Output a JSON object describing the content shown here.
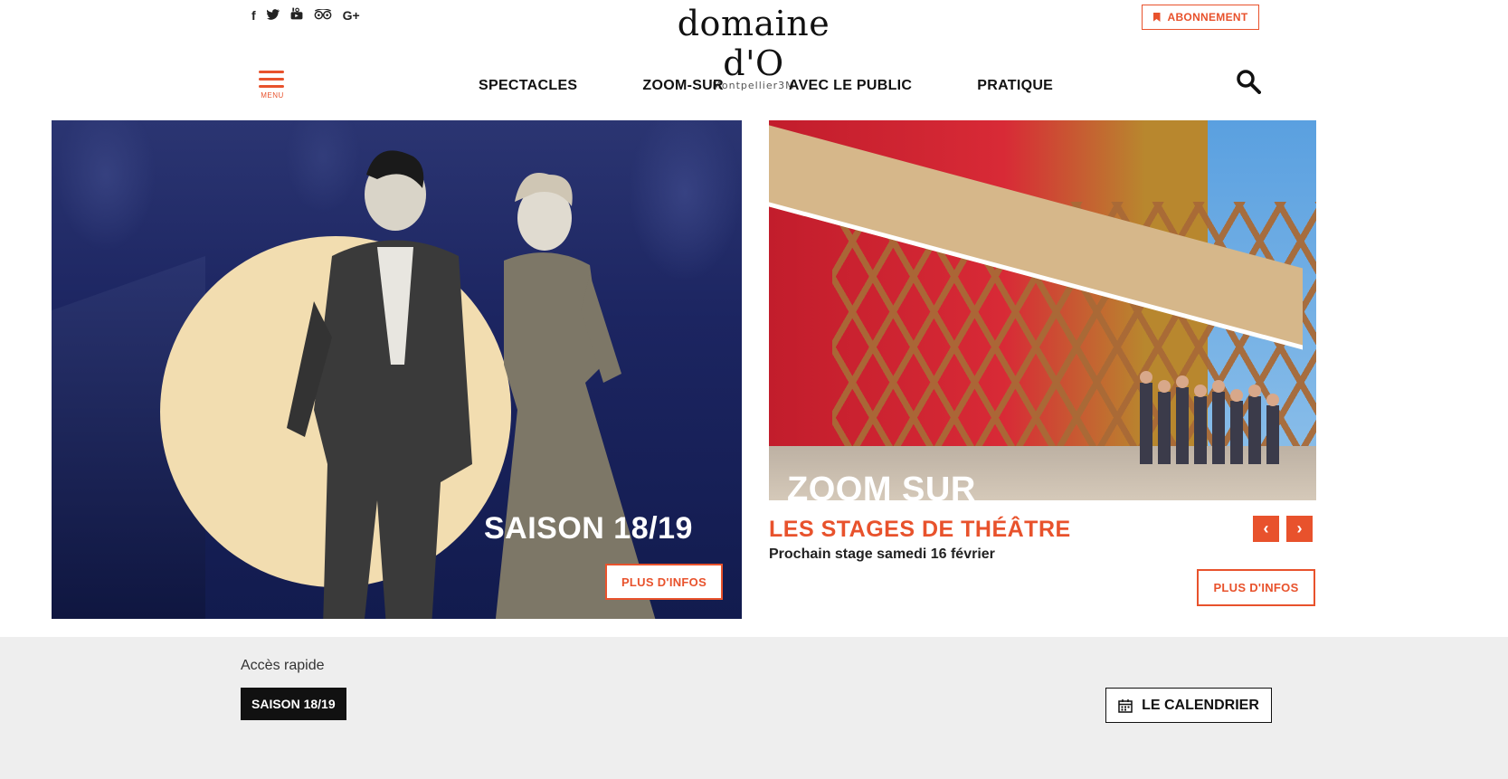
{
  "header": {
    "social": [
      {
        "name": "facebook",
        "glyph": "f"
      },
      {
        "name": "twitter",
        "glyph": "t"
      },
      {
        "name": "youtube",
        "glyph": "▶"
      },
      {
        "name": "tripadvisor",
        "glyph": "◎"
      },
      {
        "name": "google-plus",
        "glyph": "G+"
      }
    ],
    "logo_main": "domaine d'O",
    "logo_sub": "Montpellier3M",
    "abonnement_label": "ABONNEMENT"
  },
  "nav": {
    "menu_label": "MENU",
    "items": [
      "SPECTACLES",
      "ZOOM-SUR",
      "AVEC LE PUBLIC",
      "PRATIQUE"
    ]
  },
  "hero": {
    "title": "SAISON 18/19",
    "button_label": "PLUS D'INFOS"
  },
  "feature": {
    "overlay_label": "ZOOM SUR",
    "title": "LES STAGES DE THÉÂTRE",
    "subtitle": "Prochain stage samedi 16 février",
    "button_label": "PLUS D'INFOS",
    "prev_glyph": "‹",
    "next_glyph": "›"
  },
  "quick_access": {
    "label": "Accès rapide",
    "chip_label": "SAISON 18/19",
    "calendar_label": "LE CALENDRIER"
  },
  "colors": {
    "accent": "#e8522c",
    "dark": "#111111",
    "hero_blue": "#1f2a66",
    "moon": "#f2ddb0",
    "quick_bg": "#eeeeee"
  }
}
